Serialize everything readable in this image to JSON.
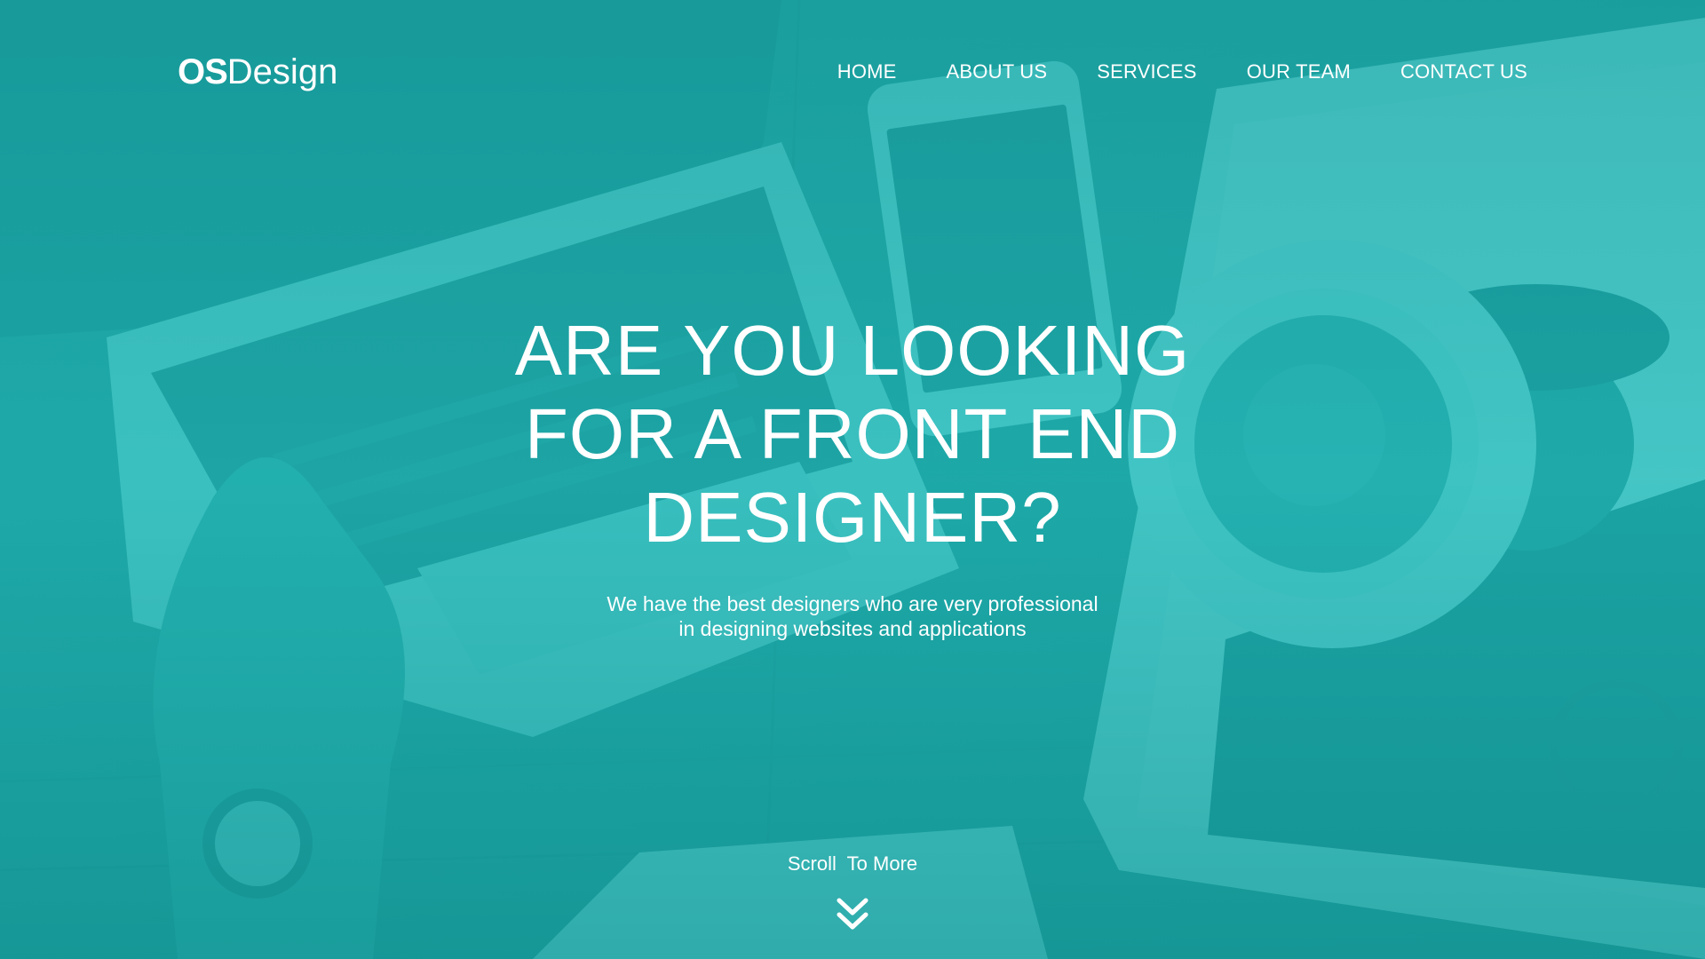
{
  "brand": {
    "bold": "OS",
    "light": "Design"
  },
  "nav": {
    "items": [
      "HOME",
      "ABOUT US",
      "SERVICES",
      "OUR TEAM",
      "CONTACT US"
    ]
  },
  "hero": {
    "headline_lines": [
      "ARE YOU LOOKING",
      "FOR A FRONT END",
      "DESIGNER?"
    ],
    "subtext_lines": [
      "We have the best designers who are very professional",
      "in designing websites and applications"
    ],
    "scroll_label": "Scroll  To More",
    "scroll_icon": "double-chevron-down-icon"
  },
  "colors": {
    "overlay": "#1fb3b3",
    "text": "#ffffff"
  }
}
